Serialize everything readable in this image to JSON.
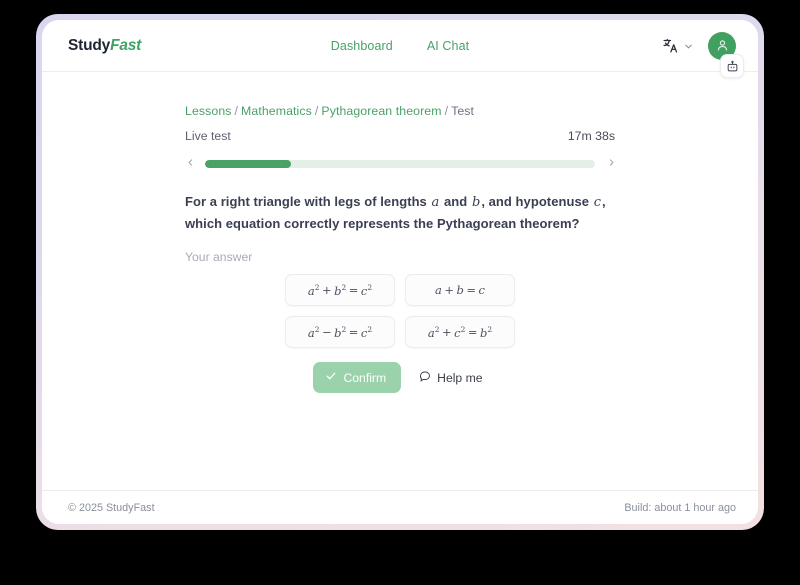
{
  "header": {
    "logo_study": "Study",
    "logo_fast": "Fast",
    "nav": [
      {
        "label": "Dashboard",
        "name": "nav-dashboard"
      },
      {
        "label": "AI Chat",
        "name": "nav-ai-chat"
      }
    ],
    "language_icon": "translate-icon",
    "chevron_icon": "chevron-down-icon",
    "avatar_icon": "user-avatar-icon",
    "avatar_color": "#40a060"
  },
  "fab": {
    "icon": "robot-icon"
  },
  "breadcrumb": {
    "items": [
      "Lessons",
      "Mathematics",
      "Pythagorean theorem",
      "Test"
    ],
    "separator": "/"
  },
  "test": {
    "status_label": "Live test",
    "timer": "17m 38s",
    "progress_percent": 22,
    "prev_icon": "chevron-left-icon",
    "next_icon": "chevron-right-icon",
    "progress_fill_color": "#4aa264",
    "progress_track_color": "#e4f0e6"
  },
  "question": {
    "part1": "For a right triangle with legs of lengths",
    "var_a": "a",
    "part2": "and",
    "var_b": "b",
    "part3": ", and hypotenuse",
    "var_c": "c",
    "part4": ", which equation correctly represents the Pythagorean theorem?",
    "answer_label": "Your answer",
    "options": [
      {
        "id": "option-1",
        "text": "a² + b² = c²"
      },
      {
        "id": "option-2",
        "text": "a + b = c"
      },
      {
        "id": "option-3",
        "text": "a² − b² = c²"
      },
      {
        "id": "option-4",
        "text": "a² + c² = b²"
      }
    ],
    "confirm_label": "Confirm",
    "confirm_icon": "check-icon",
    "help_label": "Help me",
    "help_icon": "speech-bubble-icon"
  },
  "footer": {
    "copyright": "© 2025 StudyFast",
    "build": "Build: about 1 hour ago"
  }
}
